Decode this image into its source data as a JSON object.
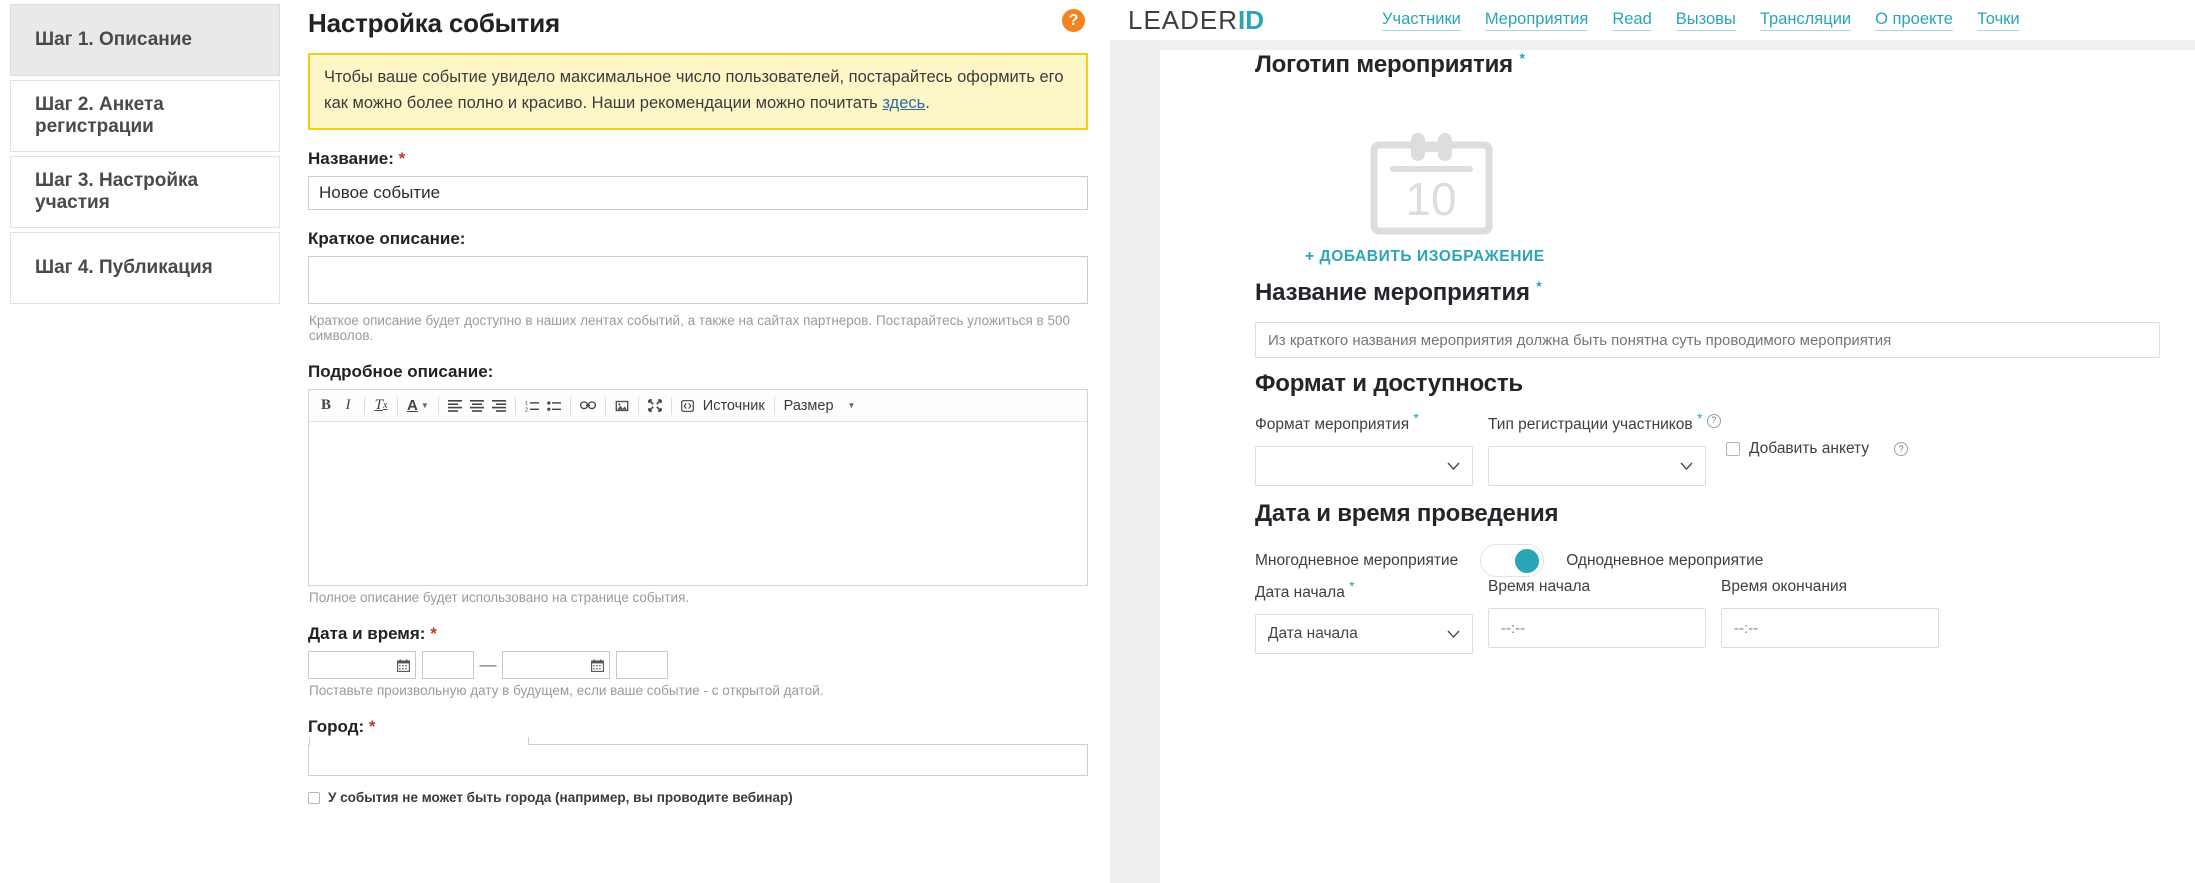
{
  "left": {
    "steps": [
      {
        "label": "Шаг 1. Описание",
        "active": true
      },
      {
        "label": "Шаг 2. Анкета регистрации",
        "active": false
      },
      {
        "label": "Шаг 3. Настройка участия",
        "active": false
      },
      {
        "label": "Шаг 4. Публикация",
        "active": false
      }
    ],
    "form_title": "Настройка события",
    "help_icon_label": "?",
    "help_icon_color": "#f58220",
    "notice": {
      "text_before": "Чтобы ваше событие увидело максимальное число пользователей, постарайтесь оформить его как можно более полно и красиво. Наши рекомендации можно почитать ",
      "link": "здесь",
      "text_after": ".",
      "bg": "#fdf7c8",
      "border": "#f0cf15"
    },
    "name": {
      "label": "Название:",
      "required": "*",
      "value": "Новое событие"
    },
    "short_desc": {
      "label": "Краткое описание:",
      "value": "",
      "hint": "Краткое описание будет доступно в наших лентах событий, а также на сайтах партнеров. Постарайтесь уложиться в 500 символов."
    },
    "full_desc": {
      "label": "Подробное описание:",
      "hint": "Полное описание будет использовано на странице события.",
      "toolbar": {
        "bold": "B",
        "italic": "I",
        "remove_format": "Tx",
        "text_color": "A",
        "align_left": "align-left",
        "align_center": "align-center",
        "align_right": "align-right",
        "numbered_list": "numbered-list",
        "bulleted_list": "bulleted-list",
        "link": "link",
        "image": "image",
        "maximize": "maximize",
        "source_label": "Источник",
        "size_label": "Размер"
      },
      "value": ""
    },
    "datetime": {
      "label": "Дата и время:",
      "required": "*",
      "start_date": "",
      "start_time": "",
      "separator": "—",
      "end_date": "",
      "end_time": "",
      "hint": "Поставьте произвольную дату в будущем, если ваше событие - с открытой датой."
    },
    "city": {
      "label": "Город:",
      "required": "*",
      "value": "",
      "checkbox_label": "У события не может быть города (например, вы проводите вебинар)",
      "checkbox_checked": false
    }
  },
  "right": {
    "brand": {
      "first": "LEADER",
      "second": "ID",
      "accent": "#2aa5b5"
    },
    "nav": [
      {
        "label": "Участники"
      },
      {
        "label": "Мероприятия"
      },
      {
        "label": "Read"
      },
      {
        "label": "Вызовы"
      },
      {
        "label": "Трансляции"
      },
      {
        "label": "О проекте"
      },
      {
        "label": "Точки"
      }
    ],
    "logo_section": {
      "title": "Логотип мероприятия",
      "required": "*",
      "placeholder_icon": "calendar-icon",
      "placeholder_day": "10",
      "add_image_label": "+ ДОБАВИТЬ ИЗОБРАЖЕНИЕ"
    },
    "name_section": {
      "title": "Название мероприятия",
      "required": "*",
      "placeholder": "Из краткого названия мероприятия должна быть понятна суть проводимого мероприятия",
      "value": ""
    },
    "format_section": {
      "title": "Формат и доступность",
      "format_label": "Формат мероприятия",
      "format_required": "*",
      "format_value": "",
      "reg_type_label": "Тип регистрации участников",
      "reg_type_required": "*",
      "reg_type_value": "",
      "reg_type_help": "?",
      "add_form_label": "Добавить анкету",
      "add_form_help": "?",
      "add_form_checked": false
    },
    "datetime_section": {
      "title": "Дата и время проведения",
      "toggle_left_label": "Многодневное мероприятие",
      "toggle_right_label": "Однодневное мероприятие",
      "toggle_on": true,
      "toggle_color": "#2aa5b5",
      "start_date_label": "Дата начала",
      "start_date_required": "*",
      "start_date_value": "Дата начала",
      "start_time_label": "Время начала",
      "start_time_value": "--:--",
      "end_time_label": "Время окончания",
      "end_time_value": "--:--"
    }
  }
}
